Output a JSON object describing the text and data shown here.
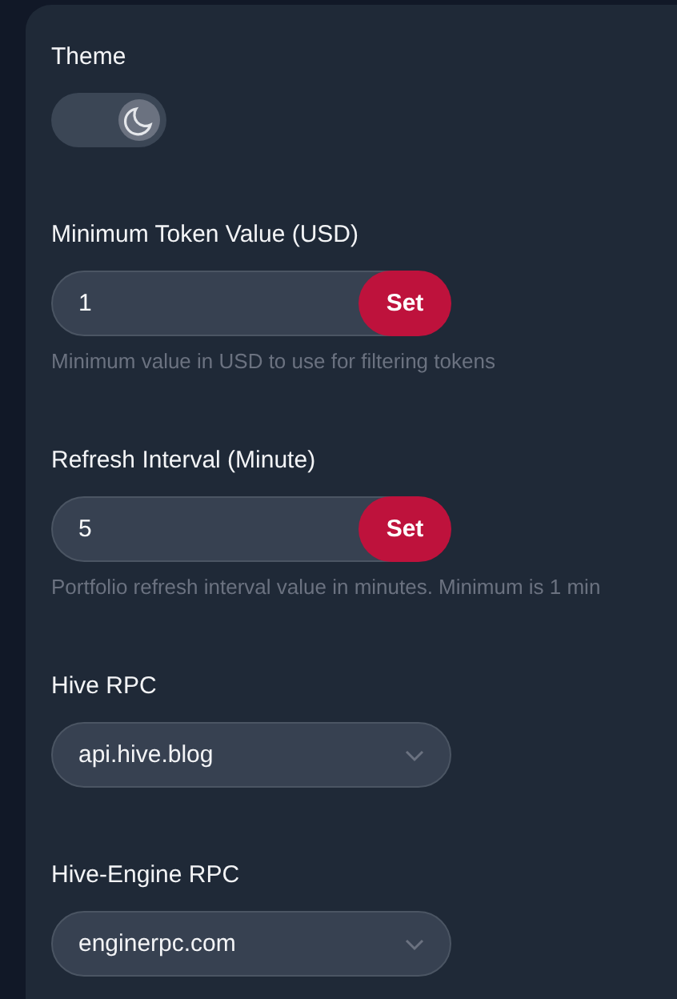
{
  "settings": [
    {
      "kind": "toggle",
      "label": "Theme",
      "on": true
    },
    {
      "kind": "input",
      "label": "Minimum Token Value (USD)",
      "value": "1",
      "button": "Set",
      "hint": "Minimum value in USD to use for filtering tokens"
    },
    {
      "kind": "input",
      "label": "Refresh Interval (Minute)",
      "value": "5",
      "button": "Set",
      "hint": "Portfolio refresh interval value in minutes. Minimum is 1 min"
    },
    {
      "kind": "select",
      "label": "Hive RPC",
      "value": "api.hive.blog"
    },
    {
      "kind": "select",
      "label": "Hive-Engine RPC",
      "value": "enginerpc.com"
    }
  ]
}
